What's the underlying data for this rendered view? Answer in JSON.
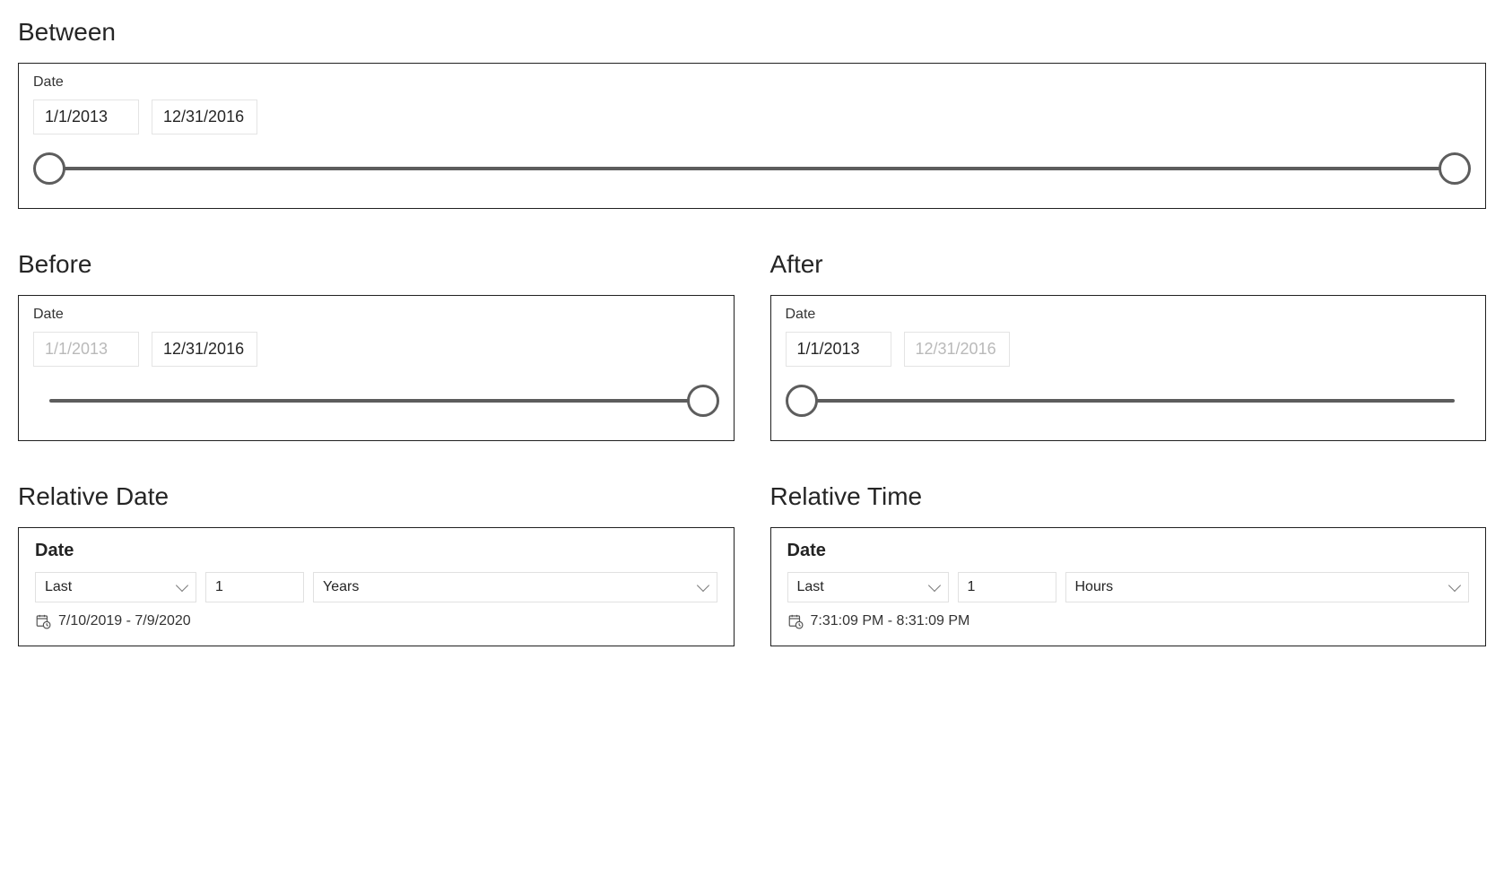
{
  "between": {
    "title": "Between",
    "label": "Date",
    "start": "1/1/2013",
    "end": "12/31/2016"
  },
  "before": {
    "title": "Before",
    "label": "Date",
    "start_placeholder": "1/1/2013",
    "end": "12/31/2016"
  },
  "after": {
    "title": "After",
    "label": "Date",
    "start": "1/1/2013",
    "end_placeholder": "12/31/2016"
  },
  "relative_date": {
    "title": "Relative Date",
    "label": "Date",
    "direction": "Last",
    "count": "1",
    "unit": "Years",
    "range_text": "7/10/2019 - 7/9/2020"
  },
  "relative_time": {
    "title": "Relative Time",
    "label": "Date",
    "direction": "Last",
    "count": "1",
    "unit": "Hours",
    "range_text": "7:31:09 PM - 8:31:09 PM"
  }
}
